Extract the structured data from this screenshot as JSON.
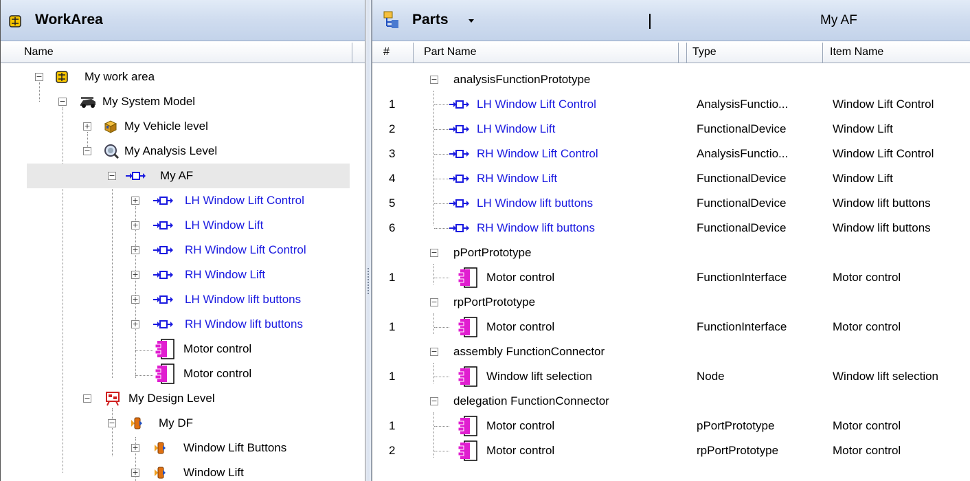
{
  "workarea": {
    "title": "WorkArea",
    "column_name": "Name",
    "tree": [
      {
        "label": "My work area",
        "icon": "workarea-icon"
      },
      {
        "label": "My System Model",
        "icon": "system-model-icon"
      },
      {
        "label": "My Vehicle level",
        "icon": "vehicle-level-icon"
      },
      {
        "label": "My Analysis Level",
        "icon": "analysis-level-icon"
      },
      {
        "label": "My AF",
        "icon": "analysis-function-icon"
      },
      {
        "label": "LH Window Lift Control",
        "icon": "analysis-function-icon"
      },
      {
        "label": "LH Window Lift",
        "icon": "analysis-function-icon"
      },
      {
        "label": "RH Window Lift Control",
        "icon": "analysis-function-icon"
      },
      {
        "label": "RH Window Lift",
        "icon": "analysis-function-icon"
      },
      {
        "label": "LH Window lift buttons",
        "icon": "analysis-function-icon"
      },
      {
        "label": "RH Window lift buttons",
        "icon": "analysis-function-icon"
      },
      {
        "label": "Motor control",
        "icon": "port-icon"
      },
      {
        "label": "Motor control",
        "icon": "port-icon"
      },
      {
        "label": "My Design Level",
        "icon": "design-level-icon"
      },
      {
        "label": "My DF",
        "icon": "design-function-icon"
      },
      {
        "label": "Window Lift Buttons",
        "icon": "design-function-icon"
      },
      {
        "label": "Window Lift",
        "icon": "design-function-icon"
      }
    ]
  },
  "parts": {
    "title": "Parts",
    "subtitle": "My AF",
    "columns": [
      "#",
      "Part Name",
      "Type",
      "Item Name"
    ],
    "groups": [
      {
        "name": "analysisFunctionPrototype"
      },
      {
        "name": "pPortPrototype"
      },
      {
        "name": "rpPortPrototype"
      },
      {
        "name": "assembly FunctionConnector"
      },
      {
        "name": "delegation FunctionConnector"
      }
    ],
    "rows": [
      {
        "num": "1",
        "part": "LH Window Lift Control",
        "type": "AnalysisFunctio...",
        "item": "Window Lift Control"
      },
      {
        "num": "2",
        "part": "LH Window Lift",
        "type": "FunctionalDevice",
        "item": "Window Lift"
      },
      {
        "num": "3",
        "part": "RH Window Lift Control",
        "type": "AnalysisFunctio...",
        "item": "Window Lift Control"
      },
      {
        "num": "4",
        "part": "RH Window Lift",
        "type": "FunctionalDevice",
        "item": "Window Lift"
      },
      {
        "num": "5",
        "part": "LH Window lift buttons",
        "type": "FunctionalDevice",
        "item": "Window lift buttons"
      },
      {
        "num": "6",
        "part": "RH Window lift buttons",
        "type": "FunctionalDevice",
        "item": "Window lift buttons"
      },
      {
        "num": "1",
        "part": "Motor control",
        "type": "FunctionInterface",
        "item": "Motor control"
      },
      {
        "num": "1",
        "part": "Motor control",
        "type": "FunctionInterface",
        "item": "Motor control"
      },
      {
        "num": "1",
        "part": "Window lift selection",
        "type": "Node",
        "item": "Window lift selection"
      },
      {
        "num": "1",
        "part": "Motor control",
        "type": "pPortPrototype",
        "item": "Motor control"
      },
      {
        "num": "2",
        "part": "Motor control",
        "type": "rpPortPrototype",
        "item": "Motor control"
      }
    ]
  },
  "colors": {
    "link_blue": "#1a1ae0",
    "port_magenta": "#e01ed0",
    "header_blue": "#cfdcef",
    "selection_gray": "#e8e8e8"
  }
}
